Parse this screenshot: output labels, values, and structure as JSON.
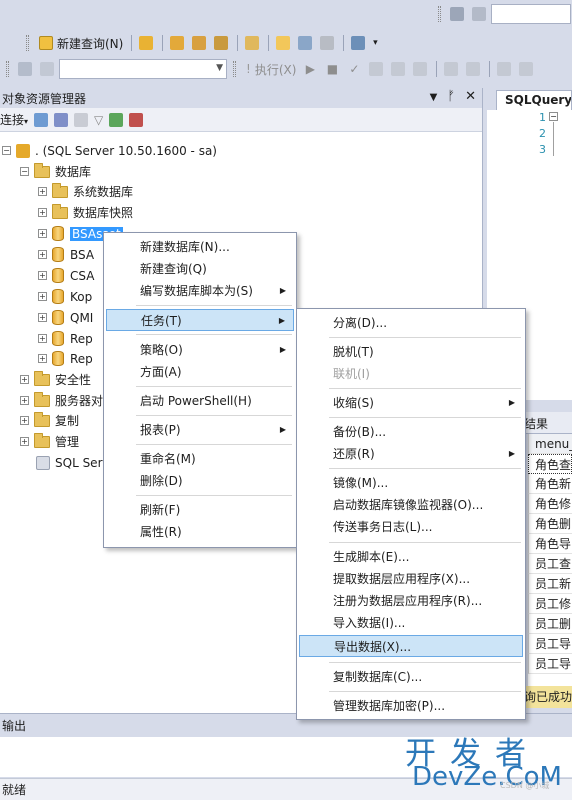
{
  "toolbar": {
    "new_query_label": "新建查询(N)",
    "execute_label": "执行(X)"
  },
  "object_explorer": {
    "title": "对象资源管理器",
    "connect_label": "连接",
    "pin_glyph": "ᚠ",
    "close_glyph": "✕",
    "server_label": ". (SQL Server 10.50.1600 - sa)",
    "nodes": [
      {
        "label": "数据库"
      },
      {
        "label": "系统数据库"
      },
      {
        "label": "数据库快照"
      },
      {
        "label": "BSAsset"
      },
      {
        "label": "BSA"
      },
      {
        "label": "CSA"
      },
      {
        "label": "Kop"
      },
      {
        "label": "QMI"
      },
      {
        "label": "Rep"
      },
      {
        "label": "Rep"
      },
      {
        "label": "安全性"
      },
      {
        "label": "服务器对"
      },
      {
        "label": "复制"
      },
      {
        "label": "管理"
      },
      {
        "label": "SQL Ser"
      }
    ]
  },
  "editor": {
    "tab_label": "SQLQuery",
    "line_numbers": [
      "1",
      "2",
      "3"
    ]
  },
  "results": {
    "tab_label": "结果",
    "column_header": "menu_n",
    "rows": [
      "角色查",
      "角色新",
      "角色修",
      "角色删",
      "角色导",
      "员工查",
      "员工新",
      "员工修",
      "员工删",
      "员工导",
      "员工导"
    ],
    "status_text": "询已成功"
  },
  "context_menu": {
    "items": [
      {
        "label": "新建数据库(N)..."
      },
      {
        "label": "新建查询(Q)"
      },
      {
        "label": "编写数据库脚本为(S)"
      },
      {
        "label": "任务(T)"
      },
      {
        "label": "策略(O)"
      },
      {
        "label": "方面(A)"
      },
      {
        "label": "启动 PowerShell(H)"
      },
      {
        "label": "报表(P)"
      },
      {
        "label": "重命名(M)"
      },
      {
        "label": "删除(D)"
      },
      {
        "label": "刷新(F)"
      },
      {
        "label": "属性(R)"
      }
    ]
  },
  "tasks_submenu": {
    "items": [
      {
        "label": "分离(D)..."
      },
      {
        "label": "脱机(T)"
      },
      {
        "label": "联机(I)"
      },
      {
        "label": "收缩(S)"
      },
      {
        "label": "备份(B)..."
      },
      {
        "label": "还原(R)"
      },
      {
        "label": "镜像(M)..."
      },
      {
        "label": "启动数据库镜像监视器(O)..."
      },
      {
        "label": "传送事务日志(L)..."
      },
      {
        "label": "生成脚本(E)..."
      },
      {
        "label": "提取数据层应用程序(X)..."
      },
      {
        "label": "注册为数据层应用程序(R)..."
      },
      {
        "label": "导入数据(I)..."
      },
      {
        "label": "导出数据(X)..."
      },
      {
        "label": "复制数据库(C)..."
      },
      {
        "label": "管理数据库加密(P)..."
      }
    ]
  },
  "output_panel": {
    "title": "输出"
  },
  "status_bar": {
    "text": "就绪"
  },
  "watermark": {
    "main": "开发者",
    "sub": "DevZe.CoM",
    "tiny": "CSDN @小城"
  }
}
